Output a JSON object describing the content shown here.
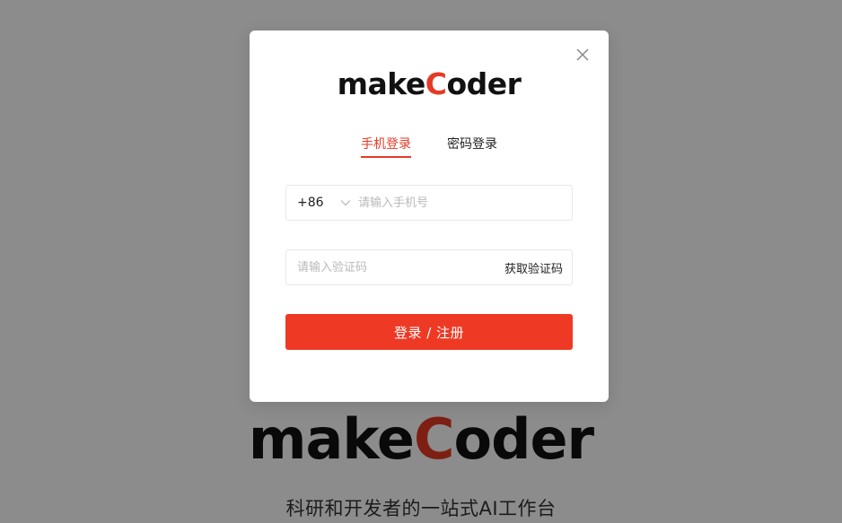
{
  "background": {
    "logo_prefix": "make",
    "logo_accent": "C",
    "logo_suffix": "oder",
    "slogan": "科研和开发者的一站式AI工作台"
  },
  "modal": {
    "logo_prefix": "make",
    "logo_accent": "C",
    "logo_suffix": "oder",
    "close_icon": "close-icon",
    "tabs": [
      {
        "label": "手机登录",
        "active": true
      },
      {
        "label": "密码登录",
        "active": false
      }
    ],
    "phone": {
      "country_code": "+86",
      "placeholder": "请输入手机号",
      "value": ""
    },
    "code": {
      "placeholder": "请输入验证码",
      "value": "",
      "get_code_label": "获取验证码"
    },
    "submit_label": "登录 / 注册"
  },
  "colors": {
    "accent": "#e53a26",
    "button": "#ee3a25",
    "overlay": "rgba(0,0,0,0.45)"
  }
}
